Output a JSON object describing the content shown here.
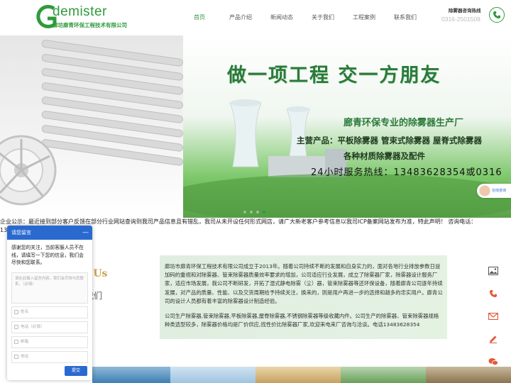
{
  "logo": {
    "word": "demister",
    "company": "廊坊廊青环保工程技术有限公司"
  },
  "nav": [
    "首页",
    "产品介绍",
    "新闻动态",
    "关于我们",
    "工程案例",
    "联系我们"
  ],
  "hotline": {
    "label": "除雾器咨询热线",
    "number": "0316-2501508"
  },
  "banner": {
    "headline": "做一项工程 交一方朋友",
    "subhead": "廊青环保专业的除雾器生产厂",
    "main_products": "主营产品：平板除雾器  管束式除雾器  屋脊式除雾器",
    "materials": "各种材质除雾器及配件",
    "service_line": "24小时服务热线：13483628354或0316",
    "online_label": "在线咨询"
  },
  "notice": {
    "text": "企业公示：最近接到部分客户反馈在部分行业网站查询到我司产品信息且有错乱，我司从未开设任何形式网店，请广大新老客户参考信息以我司ICP备案网站发布为准，特此声明！ 咨询电话：",
    "number_tail": "134"
  },
  "about": {
    "title_en": "t Us",
    "title_cn": "我们",
    "p1": "廊坊市廊青环保工程技术有限公司成立于2013年。随着公司持续不断的发展和自身实力的，面对各地行业排放参数日益加码的重视和对除雾器、管束除雾器质量效率要求的增加，公司适应行业发展，成立了除雾器厂家，除雾器设计服务厂家，适应市场发展，我公司不断研发，开拓了湿式静电除雾（尘）器，管束除雾器等还环保设备，随着廊青公司逐年持续发展，对产品的质量、性能、以及交货周期给予持续关注，换来的，则是用户再进一步的选择和越多的忠实用户。廊青公司的设计人员都有着丰富的除雾器设计制造经验。",
    "p2": "公司生产除雾器,管束除雾器,平板除雾器,屋脊除雾器,不锈钢除雾器等级收藏内件。公司生产的除雾器、管束除雾器规格种类选型较多，除雾器价格均是厂价供应,找性价比除雾器厂家,欢迎来电来厂咨询与洽谈。电话13483628354"
  },
  "chat": {
    "title": "请您留言",
    "minimize": "—",
    "greeting": "感谢您的关注，当前客服人员不在线，请填写一下您的信息，我们会尽快和您联系。",
    "message_placeholder": "请在此输入留言内容，我们会尽快与您联系。（必填）",
    "name_placeholder": "姓名",
    "phone_placeholder": "电话（必填）",
    "email_placeholder": "邮箱",
    "address_placeholder": "地址",
    "submit": "提交"
  },
  "colors": {
    "brand_green": "#2f9a3c",
    "chat_blue": "#2a6ad0",
    "about_gold": "#c8a24a"
  },
  "icons": [
    "image-icon",
    "phone-icon",
    "mail-icon",
    "edit-icon",
    "wechat-icon"
  ]
}
